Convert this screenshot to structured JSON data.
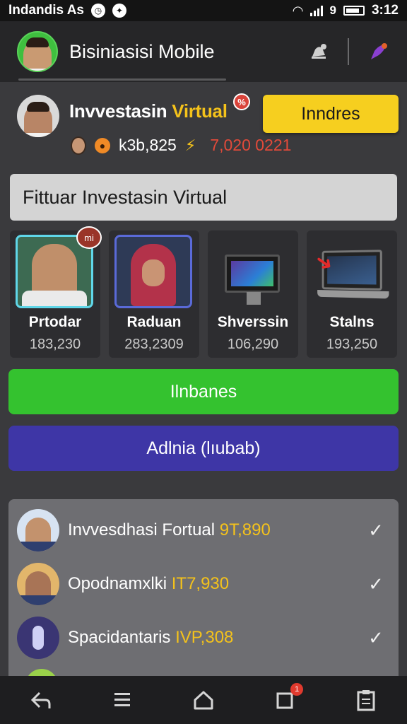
{
  "status_bar": {
    "carrier": "Indandis As",
    "time": "3:12",
    "battery_label": "9",
    "icons": [
      "notification-icon",
      "sync-icon",
      "wifi-icon",
      "signal-icon",
      "battery-icon"
    ]
  },
  "header": {
    "title": "Bisiniasisi Mobile",
    "icons": [
      "notification-bell-icon",
      "feather-pen-icon"
    ]
  },
  "profile": {
    "name_main": "Invvestasin",
    "name_accent": "Virtual",
    "badge": "%",
    "cta_label": "Inndres",
    "stat_primary": "k3b,825",
    "stat_secondary": "7,020 0221"
  },
  "section": {
    "title": "Fittuar Investasin Virtual"
  },
  "cards": [
    {
      "label": "Prtodar",
      "value": "183,230",
      "badge": "mi"
    },
    {
      "label": "Raduan",
      "value": "283,2309"
    },
    {
      "label": "Shverssin",
      "value": "106,290"
    },
    {
      "label": "Stalns",
      "value": "193,250"
    }
  ],
  "buttons": {
    "primary": "Ilnbanes",
    "secondary": "Adlnia (lıubab)"
  },
  "list": [
    {
      "name": "Invvesdhasi Fortual",
      "value": "9T,890"
    },
    {
      "name": "Opodnamxlki",
      "value": "IT7,930"
    },
    {
      "name": "Spacidantaris",
      "value": "IVP,308"
    }
  ],
  "bottom_nav": {
    "items": [
      "back-icon",
      "menu-icon",
      "home-icon",
      "notifications-icon",
      "clipboard-icon"
    ],
    "badge": "1"
  },
  "colors": {
    "accent_yellow": "#f6cf1f",
    "primary_green": "#34c22f",
    "secondary_purple": "#3e36a6",
    "stat_red": "#e24a3a"
  }
}
